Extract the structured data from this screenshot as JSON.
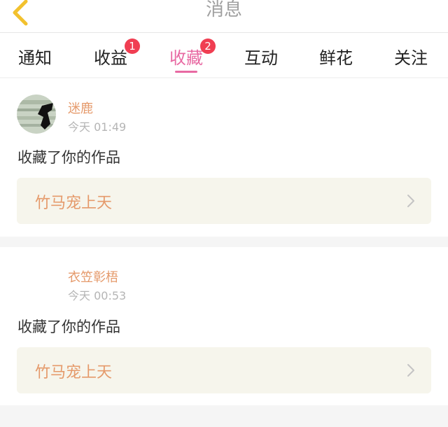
{
  "header": {
    "title": "消息",
    "back_icon": "chevron-left-icon",
    "back_icon_color": "#f2c12e"
  },
  "tabs": [
    {
      "label": "通知",
      "badge": null,
      "active": false
    },
    {
      "label": "收益",
      "badge": "1",
      "active": false
    },
    {
      "label": "收藏",
      "badge": "2",
      "active": true
    },
    {
      "label": "互动",
      "badge": null,
      "active": false
    },
    {
      "label": "鲜花",
      "badge": null,
      "active": false
    },
    {
      "label": "关注",
      "badge": null,
      "active": false
    }
  ],
  "colors": {
    "accent": "#e86aa3",
    "badge": "#f03e52",
    "username": "#e59a6b",
    "link_bg": "#f6f5ec"
  },
  "messages": [
    {
      "username": "迷鹿",
      "time": "今天 01:49",
      "action": "收藏了你的作品",
      "work_title": "竹马宠上天",
      "has_avatar": true
    },
    {
      "username": "衣笠彰梧",
      "time": "今天 00:53",
      "action": "收藏了你的作品",
      "work_title": "竹马宠上天",
      "has_avatar": false
    }
  ]
}
